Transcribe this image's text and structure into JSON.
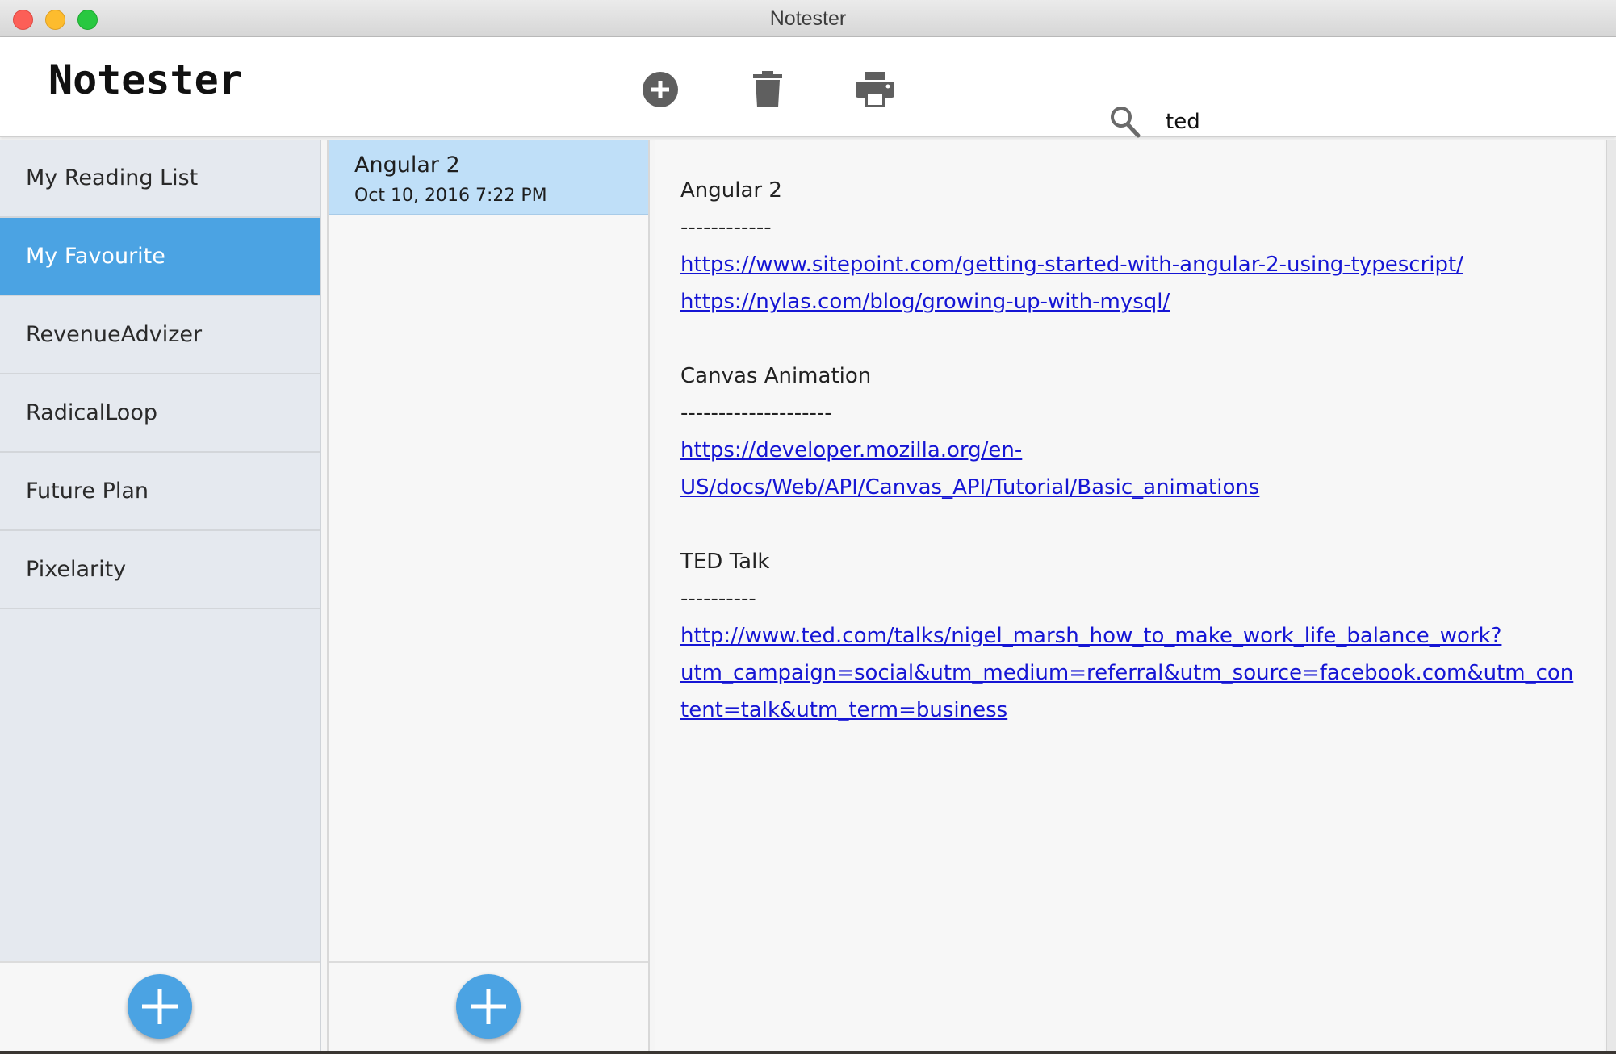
{
  "window": {
    "title": "Notester"
  },
  "header": {
    "app_title": "Notester",
    "toolbar": {
      "add_icon": "plus-circle-icon",
      "delete_icon": "trash-icon",
      "print_icon": "printer-icon"
    },
    "search": {
      "value": "ted",
      "placeholder": ""
    }
  },
  "sidebar": {
    "notebooks": [
      {
        "label": "My Reading List",
        "selected": false
      },
      {
        "label": "My Favourite",
        "selected": true
      },
      {
        "label": "RevenueAdvizer",
        "selected": false
      },
      {
        "label": "RadicalLoop",
        "selected": false
      },
      {
        "label": "Future Plan",
        "selected": false
      },
      {
        "label": "Pixelarity",
        "selected": false
      }
    ],
    "add_icon": "plus-icon"
  },
  "notes": {
    "items": [
      {
        "title": "Angular 2",
        "date": "Oct 10, 2016 7:22 PM",
        "selected": true
      }
    ],
    "add_icon": "plus-icon"
  },
  "content": {
    "sections": [
      {
        "heading": "Angular 2",
        "rule": "------------",
        "links": [
          {
            "line1": "https://www.sitepoint.com/getting-started-with-angular-2-using-typescript/"
          },
          {
            "line1": "https://nylas.com/blog/growing-up-with-mysql/"
          }
        ]
      },
      {
        "heading": "Canvas Animation",
        "rule": "--------------------",
        "links": [
          {
            "line1": "https://developer.mozilla.org/en-",
            "line2": "US/docs/Web/API/Canvas_API/Tutorial/Basic_animations"
          }
        ]
      },
      {
        "heading": "TED Talk",
        "rule": "----------",
        "links": [
          {
            "line1": "http://www.ted.com/talks/nigel_marsh_how_to_make_work_life_balance_work?",
            "line2": "utm_campaign=social&utm_medium=referral&utm_source=facebook.com&utm_con",
            "line3": "tent=talk&utm_term=business"
          }
        ]
      }
    ]
  },
  "colors": {
    "accent": "#4ba3e3",
    "selected_note": "#bfdff8",
    "link": "#1515d4",
    "search_underline": "#1f5fa9"
  }
}
